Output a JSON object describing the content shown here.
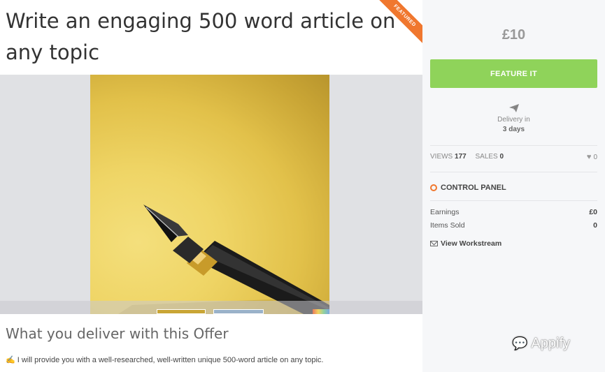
{
  "offer": {
    "title": "Write an engaging 500 word article on any topic",
    "ribbon": "FEATURED",
    "deliver_heading": "What you deliver with this Offer",
    "deliver_emoji": "✍",
    "deliver_text": "I will provide you with a well-researched, well-written unique 500-word article on any topic."
  },
  "gallery": {
    "image_icon": "fountain-pen-photo",
    "thumbnails": [
      "thumb-1",
      "thumb-2",
      "thumb-3"
    ]
  },
  "sidebar": {
    "price": "£10",
    "feature_button": "FEATURE IT",
    "delivery_icon": "paper-plane-icon",
    "delivery_label": "Delivery in",
    "delivery_value": "3 days",
    "views_label": "VIEWS",
    "views_value": "177",
    "sales_label": "SALES",
    "sales_value": "0",
    "likes_value": "0",
    "control_panel_title": "CONTROL PANEL",
    "earnings_label": "Earnings",
    "earnings_value": "£0",
    "items_sold_label": "Items Sold",
    "items_sold_value": "0",
    "workstream_label": "View Workstream"
  },
  "watermark": {
    "text": "Appify"
  },
  "colors": {
    "accent_green": "#8fd35a",
    "ribbon_orange": "#f0772e",
    "sidebar_bg": "#f6f7f9"
  }
}
